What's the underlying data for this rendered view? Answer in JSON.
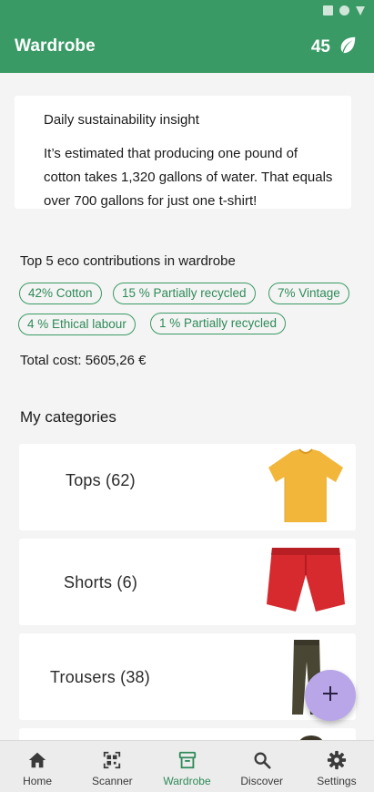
{
  "app": {
    "title": "Wardrobe",
    "eco_score": "45"
  },
  "insight": {
    "title": "Daily sustainability insight",
    "text": "It’s estimated that producing one pound of cotton takes 1,320 gallons of water. That equals over 700 gallons for just one t-shirt!"
  },
  "eco": {
    "heading": "Top 5 eco contributions in wardrobe",
    "chips": [
      "42% Cotton",
      "15 % Partially recycled",
      "7% Vintage",
      "4 % Ethical labour",
      "1 % Partially recycled"
    ]
  },
  "total_cost": "Total cost: 5605,26 €",
  "categories": {
    "heading": "My categories",
    "items": [
      {
        "label": "Tops (62)",
        "icon": "yellow-tshirt-image"
      },
      {
        "label": "Shorts (6)",
        "icon": "red-shorts-image"
      },
      {
        "label": "Trousers (38)",
        "icon": "brown-trousers-image"
      }
    ]
  },
  "fab": {
    "icon": "plus-icon"
  },
  "nav": {
    "items": [
      {
        "label": "Home",
        "icon": "home-icon"
      },
      {
        "label": "Scanner",
        "icon": "qr-scanner-icon"
      },
      {
        "label": "Wardrobe",
        "icon": "wardrobe-icon"
      },
      {
        "label": "Discover",
        "icon": "search-icon"
      },
      {
        "label": "Settings",
        "icon": "gear-icon"
      }
    ],
    "active_index": 2
  },
  "colors": {
    "primary": "#3a9a65",
    "fab": "#b8a6e8",
    "chip_border": "#3a9a65"
  }
}
